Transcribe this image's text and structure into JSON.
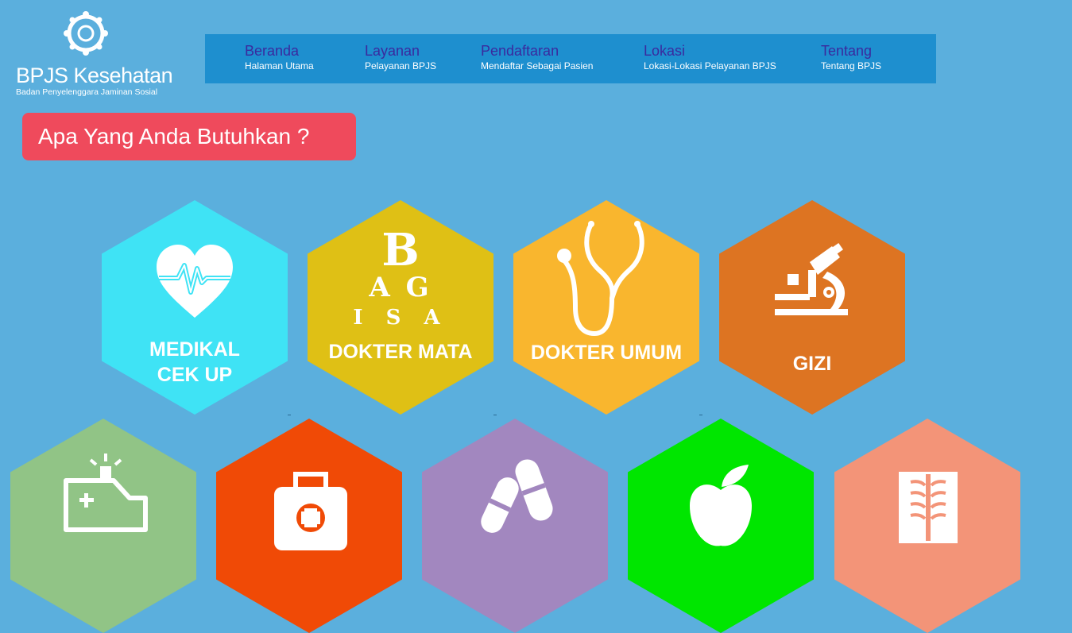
{
  "logo": {
    "name": "BPJS Kesehatan",
    "tagline": "Badan Penyelenggara Jaminan Sosial",
    "icon": "bpjs-emblem-icon"
  },
  "nav": [
    {
      "title": "Beranda",
      "subtitle": "Halaman Utama"
    },
    {
      "title": "Layanan",
      "subtitle": "Pelayanan BPJS"
    },
    {
      "title": "Pendaftaran",
      "subtitle": "Mendaftar Sebagai Pasien"
    },
    {
      "title": "Lokasi",
      "subtitle": "Lokasi-Lokasi Pelayanan BPJS"
    },
    {
      "title": "Tentang",
      "subtitle": "Tentang BPJS"
    }
  ],
  "heading": "Apa Yang Anda Butuhkan ?",
  "services": [
    {
      "line1": "MEDIKAL",
      "line2": "CEK UP",
      "icon": "heart-pulse-icon",
      "color": "#3fe3f5"
    },
    {
      "line1": "DOKTER MATA",
      "line2": "",
      "icon": "eye-chart-icon",
      "color": "#dfc015",
      "chart_rows": [
        "B",
        "A G",
        "I S A"
      ]
    },
    {
      "line1": "DOKTER UMUM",
      "line2": "",
      "icon": "stethoscope-icon",
      "color": "#f9b62e"
    },
    {
      "line1": "GIZI",
      "line2": "",
      "icon": "microscope-icon",
      "color": "#dd7422"
    },
    {
      "line1": "",
      "line2": "",
      "icon": "ambulance-icon",
      "color": "#91c486"
    },
    {
      "line1": "",
      "line2": "",
      "icon": "first-aid-kit-icon",
      "color": "#f04a06"
    },
    {
      "line1": "",
      "line2": "",
      "icon": "pills-icon",
      "color": "#a287bf"
    },
    {
      "line1": "",
      "line2": "",
      "icon": "apple-icon",
      "color": "#00e600"
    },
    {
      "line1": "",
      "line2": "",
      "icon": "xray-icon",
      "color": "#f39478"
    }
  ],
  "colors": {
    "background": "#5bafdd",
    "navbar": "#1e8fcf",
    "nav_title": "#3a2a9e",
    "heading_box": "#ef4a5c"
  }
}
